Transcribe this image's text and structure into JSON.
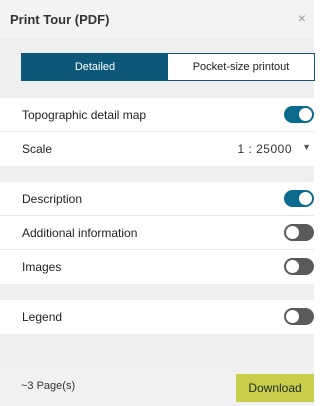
{
  "header": {
    "title": "Print Tour (PDF)",
    "close_glyph": "×"
  },
  "format_tabs": [
    {
      "label": "Detailed",
      "active": true
    },
    {
      "label": "Pocket-size printout",
      "active": false
    }
  ],
  "map_options": {
    "topographic": {
      "label": "Topographic detail map",
      "enabled": true
    },
    "scale": {
      "label": "Scale",
      "value": "1 : 25000",
      "chevron": "▼"
    }
  },
  "content_options": [
    {
      "label": "Description",
      "enabled": true
    },
    {
      "label": "Additional information",
      "enabled": false
    },
    {
      "label": "Images",
      "enabled": false
    }
  ],
  "legend_option": {
    "label": "Legend",
    "enabled": false
  },
  "footer": {
    "pages": "~3 Page(s)",
    "download_label": "Download"
  },
  "colors": {
    "accent": "#0d5878",
    "toggle_on": "#0b6a8e",
    "toggle_off": "#5a5a5a",
    "download": "#c9cf4d"
  }
}
